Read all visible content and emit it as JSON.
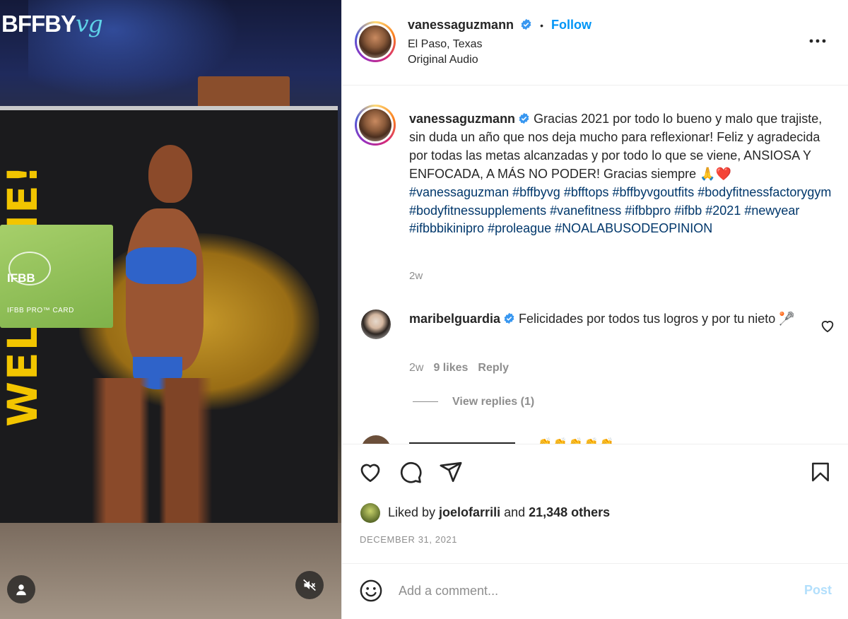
{
  "media": {
    "brand_main": "BFFBY",
    "brand_script": "vg",
    "card_brand": "IFBB",
    "card_label": "IFBB PRO™ CARD",
    "banner_text": "WELCOME!"
  },
  "header": {
    "username": "vanessaguzmann",
    "separator": "•",
    "follow_label": "Follow",
    "location": "El Paso, Texas",
    "audio": "Original Audio"
  },
  "caption": {
    "username": "vanessaguzmann",
    "text": " Gracias 2021 por todo lo bueno y malo que trajiste, sin duda un año que nos deja mucho para reflexionar! Feliz y agradecida por todas las metas alcanzadas y por todo lo que se viene, ANSIOSA Y ENFOCADA, A MÁS NO PODER! Gracias siempre 🙏❤️ ",
    "hashtags": "#vanessaguzman #bffbyvg #bfftops #bffbyvgoutfits #bodyfitnessfactorygym #bodyfitnessupplements #vanefitness #ifbbpro #ifbb #2021 #newyear #ifbbbikinipro #proleague #NOALABUSODEOPINION",
    "time": "2w"
  },
  "comment": {
    "username": "maribelguardia",
    "text": " Felicidades por todos tus logros y por tu nieto 🥍",
    "time": "2w",
    "likes": "9 likes",
    "reply_label": "Reply",
    "view_replies": "View replies (1)"
  },
  "next_comment": {
    "emoji": "👏👏👏👏👏"
  },
  "likes_row": {
    "prefix": "Liked by ",
    "user": "joelofarrili",
    "middle": " and ",
    "count": "21,348 others"
  },
  "date": "DECEMBER 31, 2021",
  "add_comment": {
    "placeholder": "Add a comment...",
    "post_label": "Post"
  },
  "colors": {
    "link_blue": "#0095f6",
    "hashtag_blue": "#00376b",
    "muted_gray": "#8e8e8e",
    "post_disabled": "#b2dffc",
    "verified_blue": "#3897f0"
  },
  "icons": [
    "verified-badge-icon",
    "more-options-icon",
    "heart-icon",
    "comment-icon",
    "share-icon",
    "bookmark-icon",
    "emoji-icon",
    "user-icon",
    "muted-audio-icon"
  ]
}
